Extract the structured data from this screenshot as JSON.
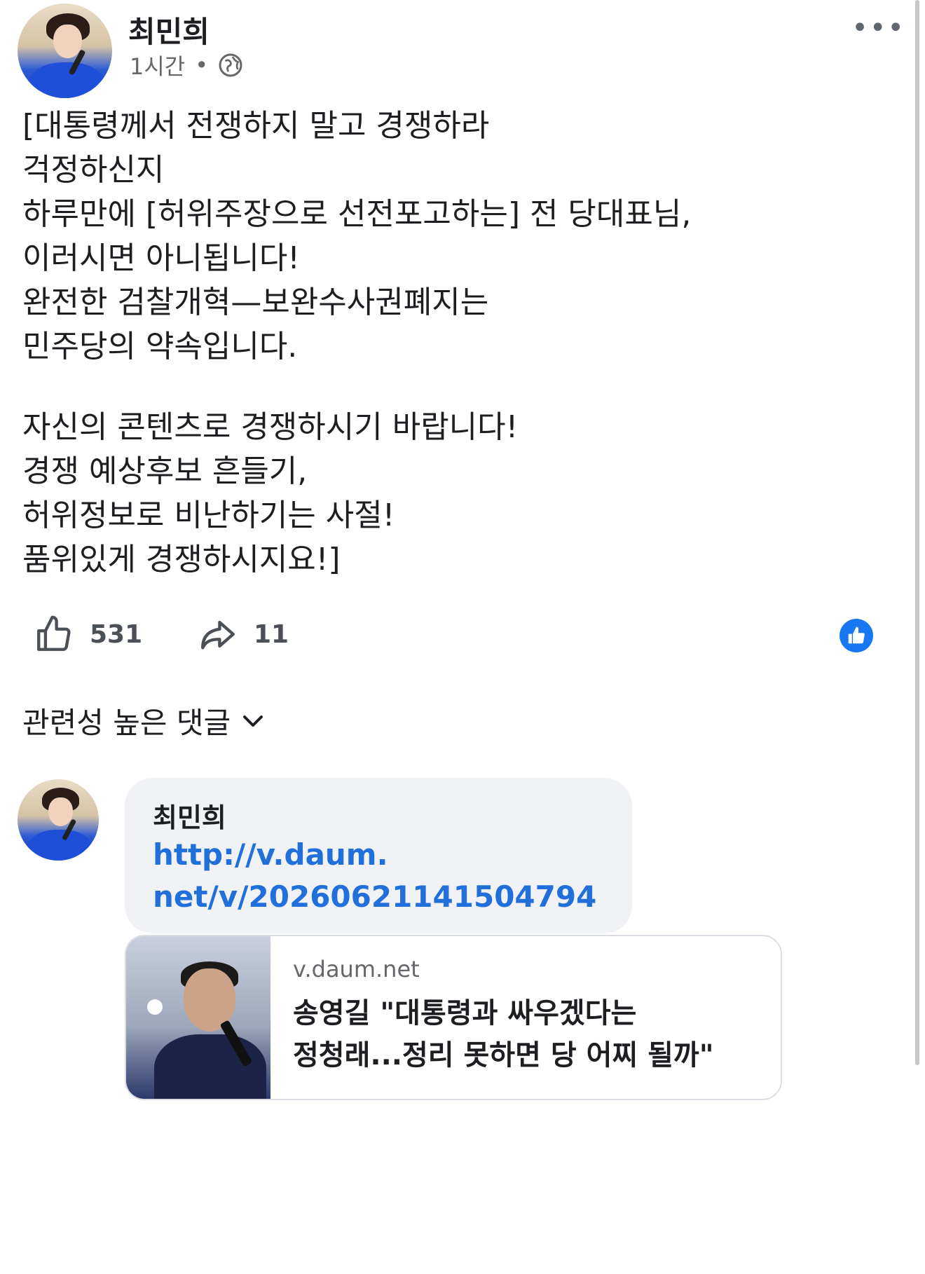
{
  "post": {
    "author": "최민희",
    "time": "1시간",
    "separator": "•",
    "more_label": "•••",
    "privacy_icon": "globe-icon",
    "body_lines_1": [
      "[대통령께서 전쟁하지 말고 경쟁하라",
      "걱정하신지",
      "하루만에 [허위주장으로 선전포고하는] 전 당대표님,",
      "이러시면 아니됩니다!",
      "완전한 검찰개혁—보완수사권폐지는",
      "민주당의 약속입니다."
    ],
    "body_lines_2": [
      "자신의 콘텐츠로 경쟁하시기 바랍니다!",
      "경쟁 예상후보 흔들기,",
      "허위정보로 비난하기는 사절!",
      "품위있게 경쟁하시지요!]"
    ]
  },
  "actions": {
    "like_count": "531",
    "share_count": "11",
    "like_icon": "thumbs-up-icon",
    "share_icon": "share-arrow-icon",
    "reaction_badge_icon": "like-badge-icon",
    "accent_color": "#1877f2"
  },
  "comments": {
    "sort_label": "관련성 높은 댓글",
    "sort_icon": "chevron-down-icon",
    "items": [
      {
        "author": "최민희",
        "link_lines": [
          "http://v.daum.",
          "net/v/20260621141504794"
        ],
        "link_color": "#216fdb",
        "preview": {
          "domain": "v.daum.net",
          "title_lines": [
            "송영길 \"대통령과 싸우겠다는",
            "정청래...정리 못하면 당 어찌 될까\""
          ]
        }
      }
    ]
  }
}
